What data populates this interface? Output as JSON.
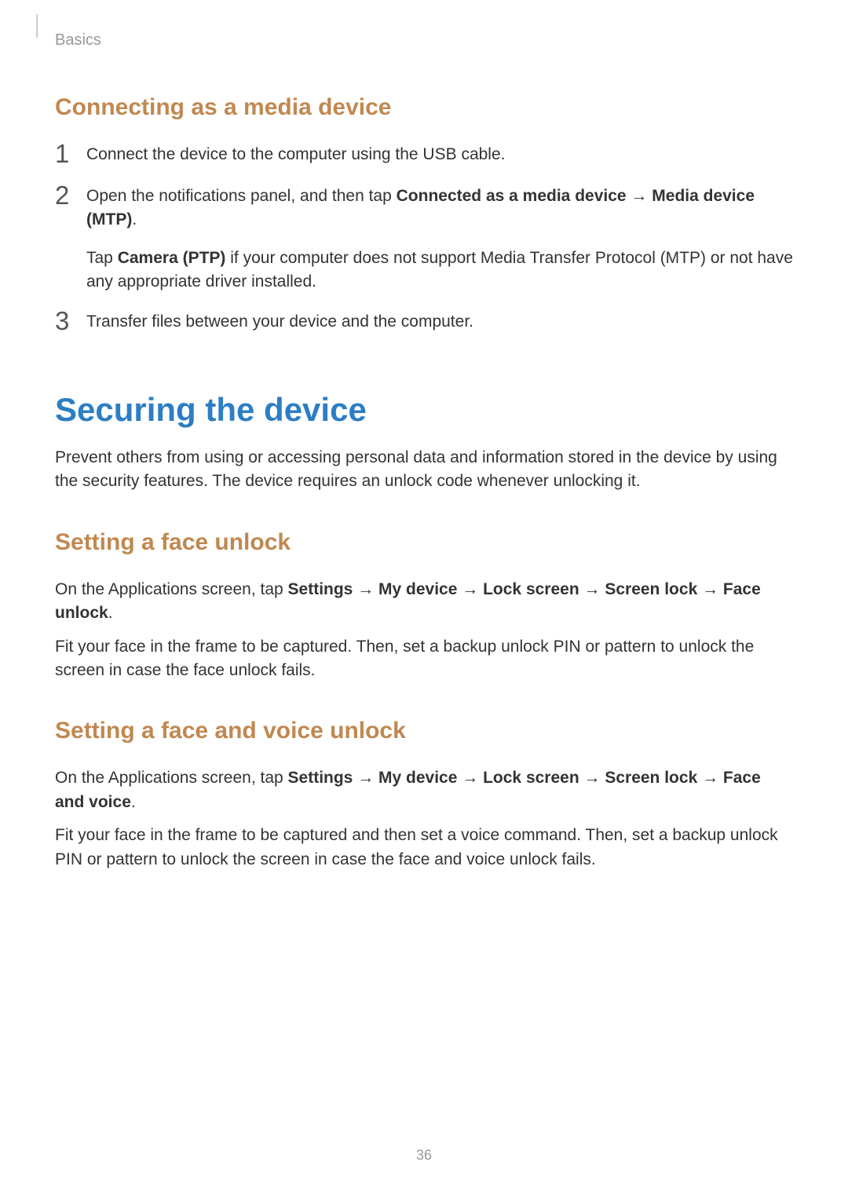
{
  "header": {
    "breadcrumb": "Basics"
  },
  "section1": {
    "heading": "Connecting as a media device",
    "step1": {
      "num": "1",
      "text": "Connect the device to the computer using the USB cable."
    },
    "step2": {
      "num": "2",
      "pre": "Open the notifications panel, and then tap ",
      "bold1": "Connected as a media device",
      "arrow1": " → ",
      "bold2": "Media device (MTP)",
      "post1": ".",
      "sub_pre": "Tap ",
      "sub_bold": "Camera (PTP)",
      "sub_post": " if your computer does not support Media Transfer Protocol (MTP) or not have any appropriate driver installed."
    },
    "step3": {
      "num": "3",
      "text": "Transfer files between your device and the computer."
    }
  },
  "section2": {
    "heading": "Securing the device",
    "intro": "Prevent others from using or accessing personal data and information stored in the device by using the security features. The device requires an unlock code whenever unlocking it."
  },
  "section3": {
    "heading": "Setting a face unlock",
    "para1_pre": "On the Applications screen, tap ",
    "para1_bold1": "Settings",
    "para1_arrow1": " → ",
    "para1_bold2": "My device",
    "para1_arrow2": " → ",
    "para1_bold3": "Lock screen",
    "para1_arrow3": " → ",
    "para1_bold4": "Screen lock",
    "para1_arrow4": " → ",
    "para1_bold5": "Face unlock",
    "para1_post": ".",
    "para2": "Fit your face in the frame to be captured. Then, set a backup unlock PIN or pattern to unlock the screen in case the face unlock fails."
  },
  "section4": {
    "heading": "Setting a face and voice unlock",
    "para1_pre": "On the Applications screen, tap ",
    "para1_bold1": "Settings",
    "para1_arrow1": " → ",
    "para1_bold2": "My device",
    "para1_arrow2": " → ",
    "para1_bold3": "Lock screen",
    "para1_arrow3": " → ",
    "para1_bold4": "Screen lock",
    "para1_arrow4": " → ",
    "para1_bold5": "Face and voice",
    "para1_post": ".",
    "para2": "Fit your face in the frame to be captured and then set a voice command. Then, set a backup unlock PIN or pattern to unlock the screen in case the face and voice unlock fails."
  },
  "pageNumber": "36"
}
